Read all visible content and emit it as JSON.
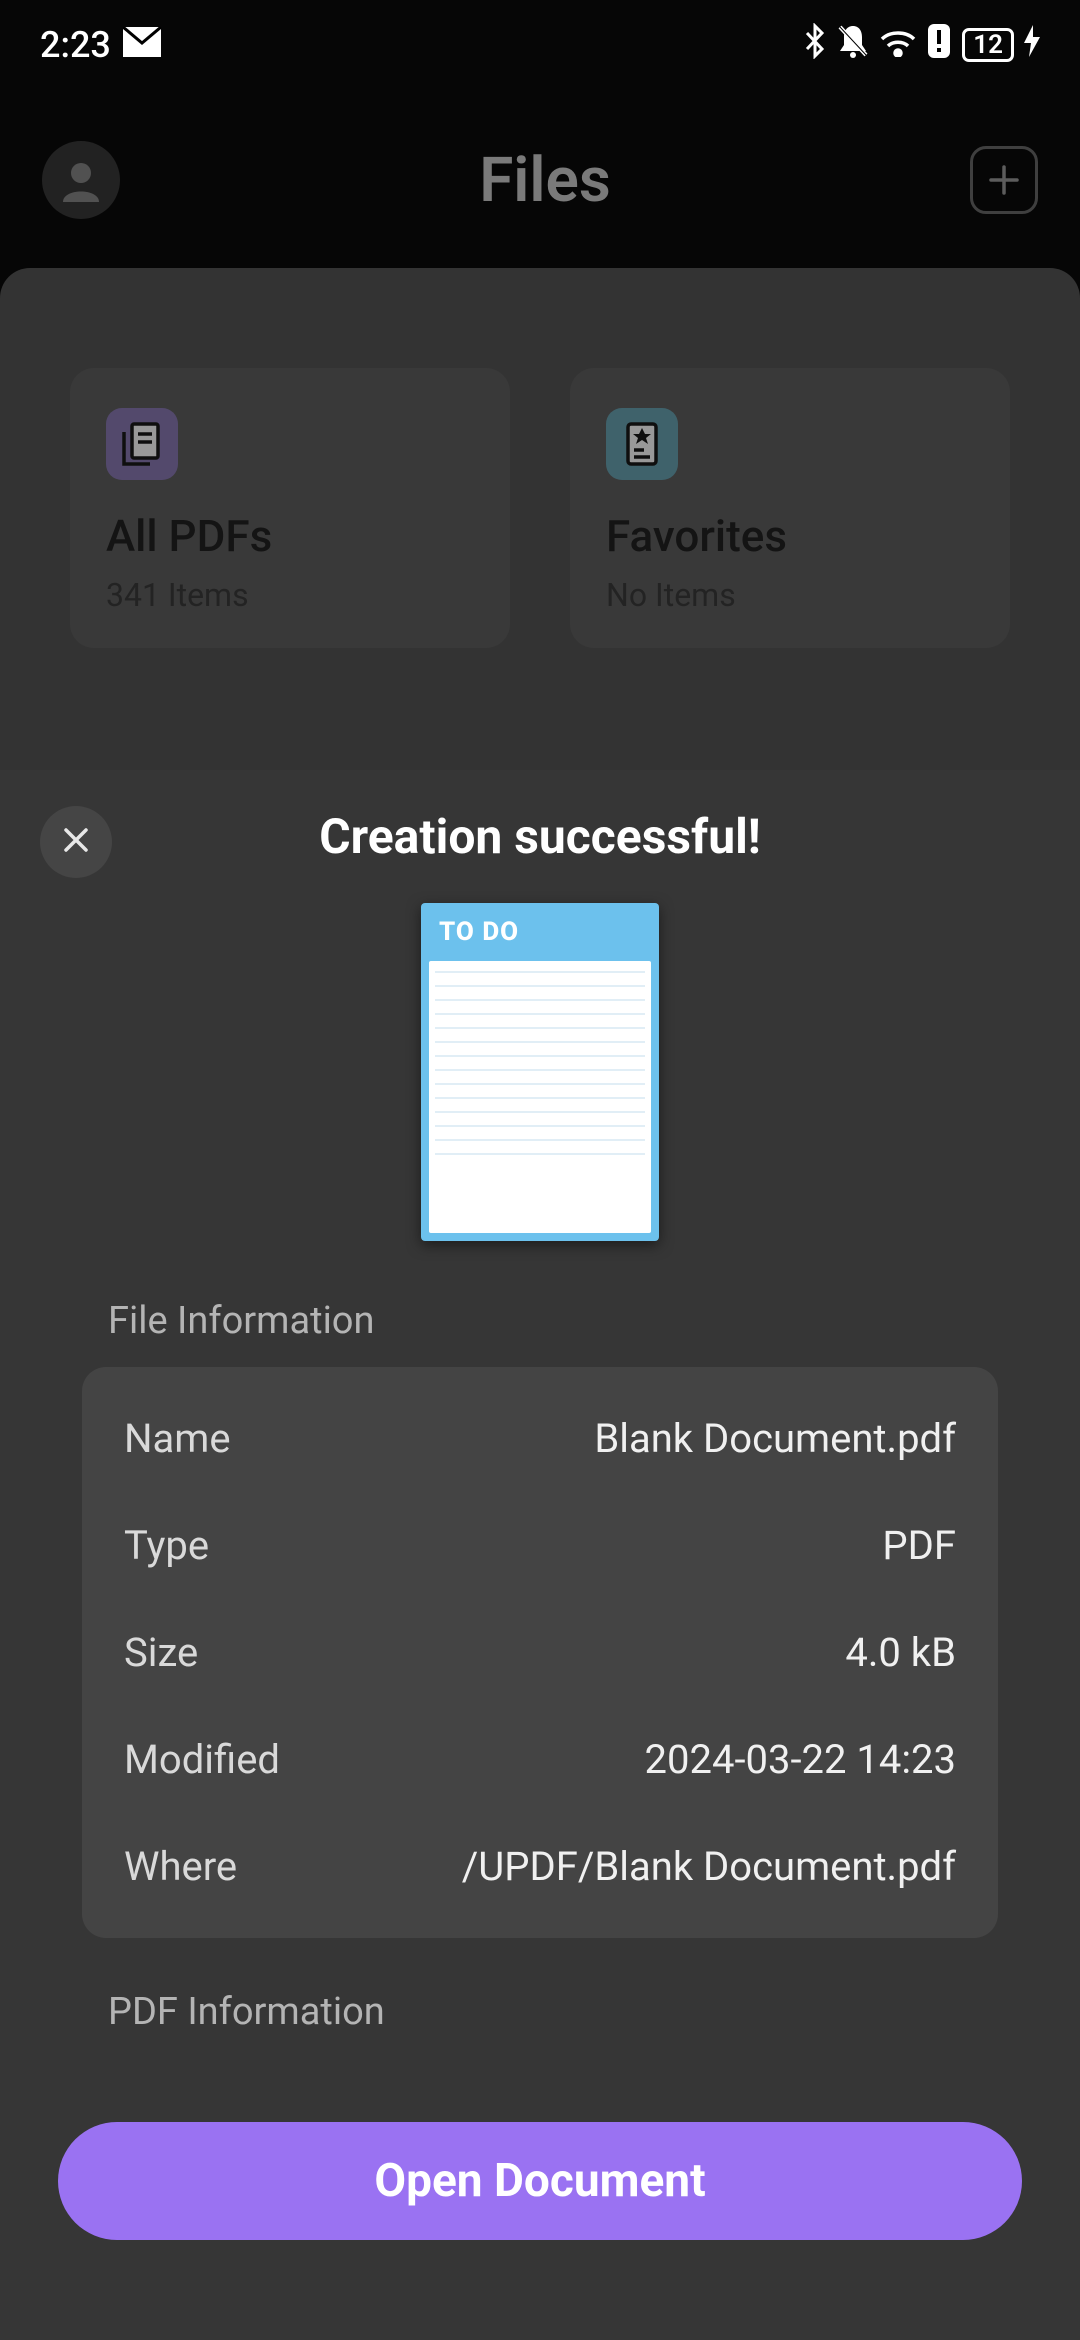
{
  "status": {
    "time": "2:23",
    "battery": "12"
  },
  "files": {
    "title": "Files",
    "cards": [
      {
        "title": "All PDFs",
        "sub": "341 Items"
      },
      {
        "title": "Favorites",
        "sub": "No Items"
      }
    ]
  },
  "sheet": {
    "title": "Creation successful!",
    "thumb_header": "TO DO",
    "file_info_label": "File Information",
    "pdf_info_label": "PDF Information",
    "rows": [
      {
        "key": "Name",
        "val": "Blank Document.pdf"
      },
      {
        "key": "Type",
        "val": "PDF"
      },
      {
        "key": "Size",
        "val": "4.0 kB"
      },
      {
        "key": "Modified",
        "val": "2024-03-22 14:23"
      },
      {
        "key": "Where",
        "val": "/UPDF/Blank Document.pdf"
      }
    ],
    "open_label": "Open Document"
  }
}
